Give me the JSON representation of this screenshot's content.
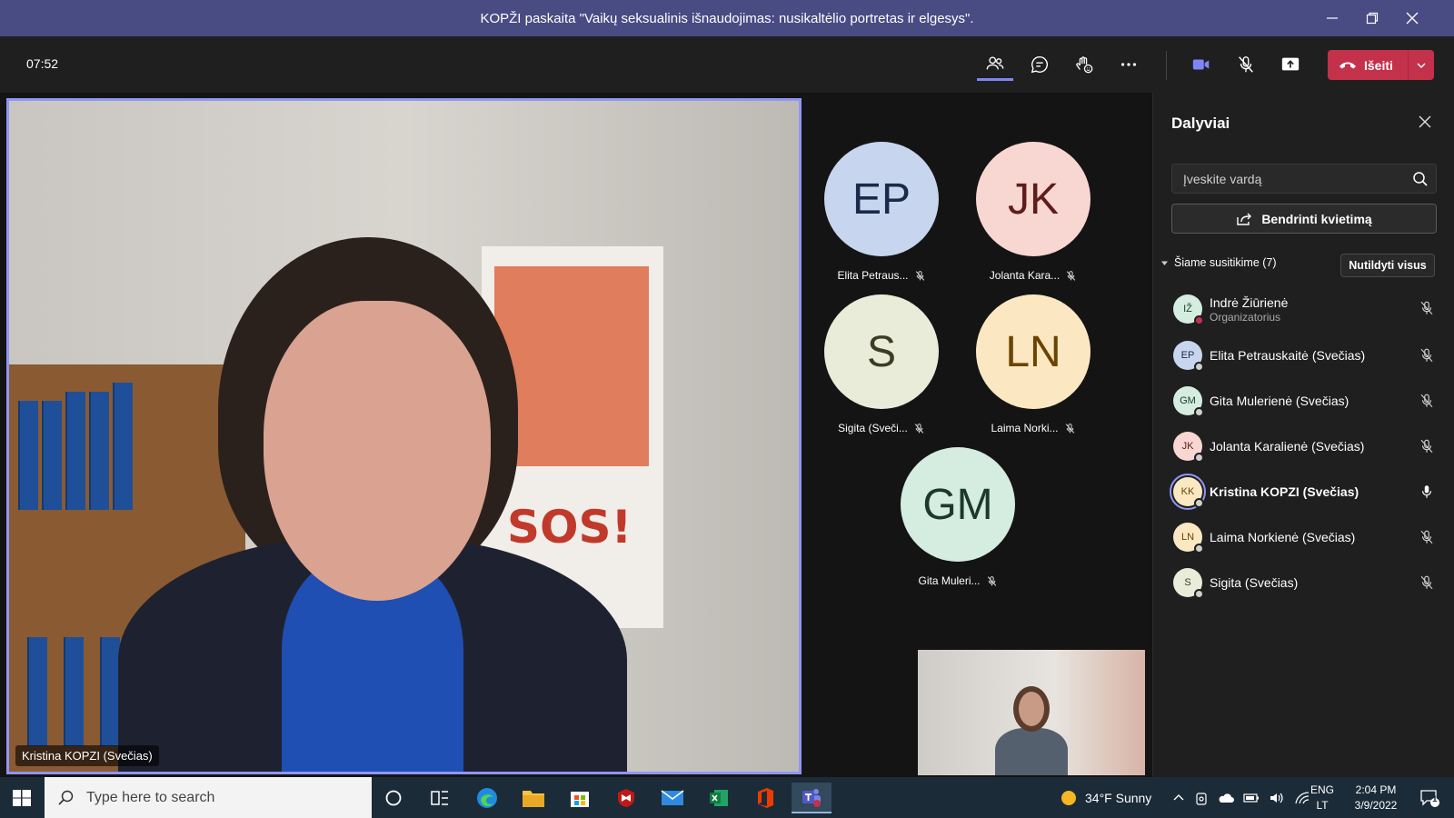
{
  "window": {
    "title": "KOPŽI paskaita \"Vaikų seksualinis išnaudojimas: nusikaltėlio portretas ir elgesys\".",
    "minimize_icon": "minimize-icon",
    "maximize_icon": "maximize-icon",
    "close_icon": "close-icon"
  },
  "toolbar": {
    "timer": "07:52",
    "leave_label": "Išeiti",
    "leave_color": "#c4314b",
    "accent": "#7f85f5"
  },
  "main_video": {
    "name_tag": "Kristina KOPZI (Svečias)"
  },
  "tiles": [
    {
      "initials": "EP",
      "label": "Elita Petraus...",
      "bg": "#c7d6ee",
      "fg": "#1b2a4a"
    },
    {
      "initials": "JK",
      "label": "Jolanta Kara...",
      "bg": "#f8d6d2",
      "fg": "#5e1d1d"
    },
    {
      "initials": "S",
      "label": "Sigita (Sveči...",
      "bg": "#e8ecd9",
      "fg": "#3c3c24"
    },
    {
      "initials": "LN",
      "label": "Laima Norki...",
      "bg": "#fbe8c2",
      "fg": "#6b4400"
    },
    {
      "initials": "GM",
      "label": "Gita Muleri...",
      "bg": "#d5ece0",
      "fg": "#1c3a2c"
    }
  ],
  "panel": {
    "title": "Dalyviai",
    "search_placeholder": "Įveskite vardą",
    "share_label": "Bendrinti kvietimą",
    "section_label": "Šiame susitikime (7)",
    "mute_all_label": "Nutildyti visus",
    "participants": [
      {
        "initials": "IŽ",
        "name": "Indrė Žiūrienė",
        "role": "Organizatorius",
        "bg": "#d5ece0",
        "fg": "#1c3a2c",
        "mic": "muted"
      },
      {
        "initials": "EP",
        "name": "Elita Petrauskaitė (Svečias)",
        "role": "",
        "bg": "#c7d6ee",
        "fg": "#1b2a4a",
        "mic": "muted"
      },
      {
        "initials": "GM",
        "name": "Gita Mulerienė (Svečias)",
        "role": "",
        "bg": "#d5ece0",
        "fg": "#1c3a2c",
        "mic": "muted"
      },
      {
        "initials": "JK",
        "name": "Jolanta Karalienė (Svečias)",
        "role": "",
        "bg": "#f8d6d2",
        "fg": "#5e1d1d",
        "mic": "muted"
      },
      {
        "initials": "KK",
        "name": "Kristina KOPZI (Svečias)",
        "role": "",
        "bg": "#fbe8c2",
        "fg": "#6b4400",
        "mic": "on"
      },
      {
        "initials": "LN",
        "name": "Laima Norkienė (Svečias)",
        "role": "",
        "bg": "#fbe8c2",
        "fg": "#6b4400",
        "mic": "muted"
      },
      {
        "initials": "S",
        "name": "Sigita (Svečias)",
        "role": "",
        "bg": "#e8ecd9",
        "fg": "#3c3c24",
        "mic": "muted"
      }
    ]
  },
  "taskbar": {
    "search_placeholder": "Type here to search",
    "weather": "34°F  Sunny",
    "lang_top": "ENG",
    "lang_bottom": "LT",
    "time": "2:04 PM",
    "date": "3/9/2022",
    "notifications": "1"
  }
}
